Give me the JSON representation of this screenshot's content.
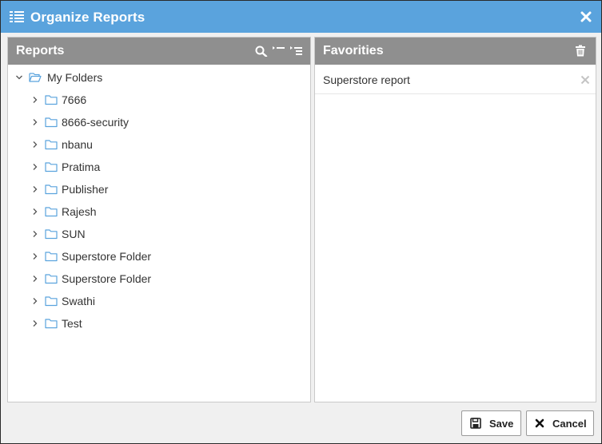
{
  "dialog": {
    "title": "Organize Reports"
  },
  "reports_panel": {
    "title": "Reports",
    "root": {
      "label": "My Folders",
      "expanded": true
    },
    "folders": [
      {
        "label": "7666"
      },
      {
        "label": "8666-security"
      },
      {
        "label": "nbanu"
      },
      {
        "label": "Pratima"
      },
      {
        "label": "Publisher"
      },
      {
        "label": "Rajesh"
      },
      {
        "label": "SUN"
      },
      {
        "label": "Superstore Folder"
      },
      {
        "label": "Superstore Folder"
      },
      {
        "label": "Swathi"
      },
      {
        "label": "Test"
      }
    ]
  },
  "favorites_panel": {
    "title": "Favorities",
    "items": [
      {
        "label": "Superstore report"
      }
    ]
  },
  "footer": {
    "save_label": "Save",
    "cancel_label": "Cancel"
  },
  "colors": {
    "titlebar": "#5aa3dd",
    "panel_header": "#8f8f8f",
    "folder_icon": "#5aa3dd"
  }
}
